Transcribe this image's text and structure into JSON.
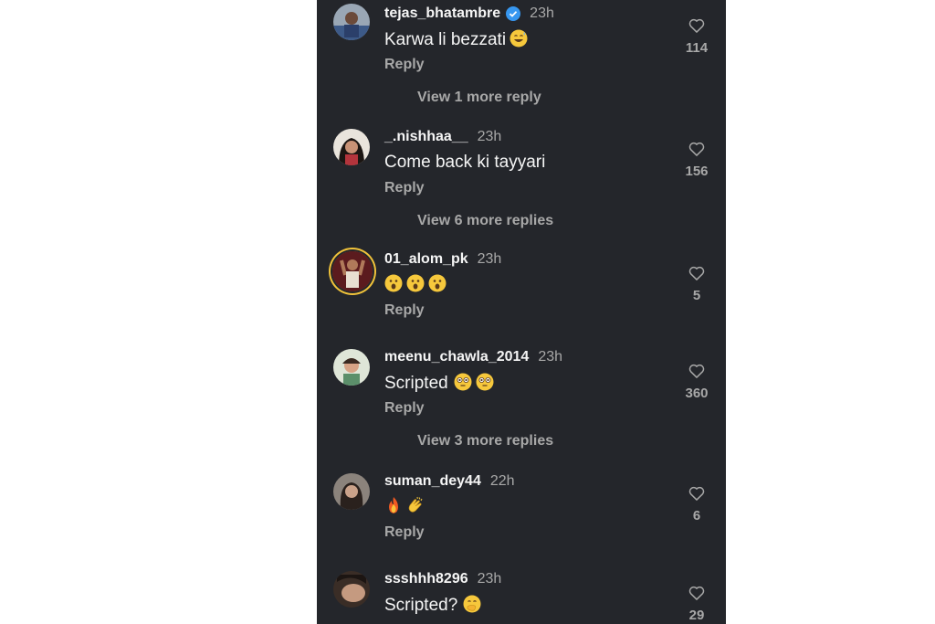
{
  "comments": [
    {
      "username": "tejas_bhatambre",
      "verified": true,
      "time": "23h",
      "text": "Karwa li bezzati",
      "emojis": [
        "grinning-sweat"
      ],
      "reply_label": "Reply",
      "view_more": "View 1 more reply",
      "likes": "114"
    },
    {
      "username": "_.nishhaa__",
      "time": "23h",
      "text": "Come back ki tayyari",
      "reply_label": "Reply",
      "view_more": "View 6 more replies",
      "likes": "156"
    },
    {
      "username": "01_alom_pk",
      "time": "23h",
      "text": "",
      "emojis": [
        "astonished",
        "astonished",
        "astonished"
      ],
      "reply_label": "Reply",
      "likes": "5"
    },
    {
      "username": "meenu_chawla_2014",
      "time": "23h",
      "text": "Scripted",
      "emojis": [
        "flushed",
        "flushed"
      ],
      "reply_label": "Reply",
      "view_more": "View 3 more replies",
      "likes": "360"
    },
    {
      "username": "suman_dey44",
      "time": "22h",
      "text": "",
      "emojis": [
        "fire",
        "clapping-hands"
      ],
      "reply_label": "Reply",
      "likes": "6"
    },
    {
      "username": "ssshhh8296",
      "time": "23h",
      "text": "Scripted?",
      "emojis": [
        "face-with-hand-over-mouth"
      ],
      "likes": "29"
    }
  ],
  "colors": {
    "background": "#24262b",
    "text_primary": "#f5f5f5",
    "text_secondary": "#a8a8a8",
    "verified_blue": "#3797f0",
    "story_ring": "#f0c23a"
  },
  "icons": {
    "like": "heart-outline-icon",
    "verified": "verified-badge-icon"
  }
}
